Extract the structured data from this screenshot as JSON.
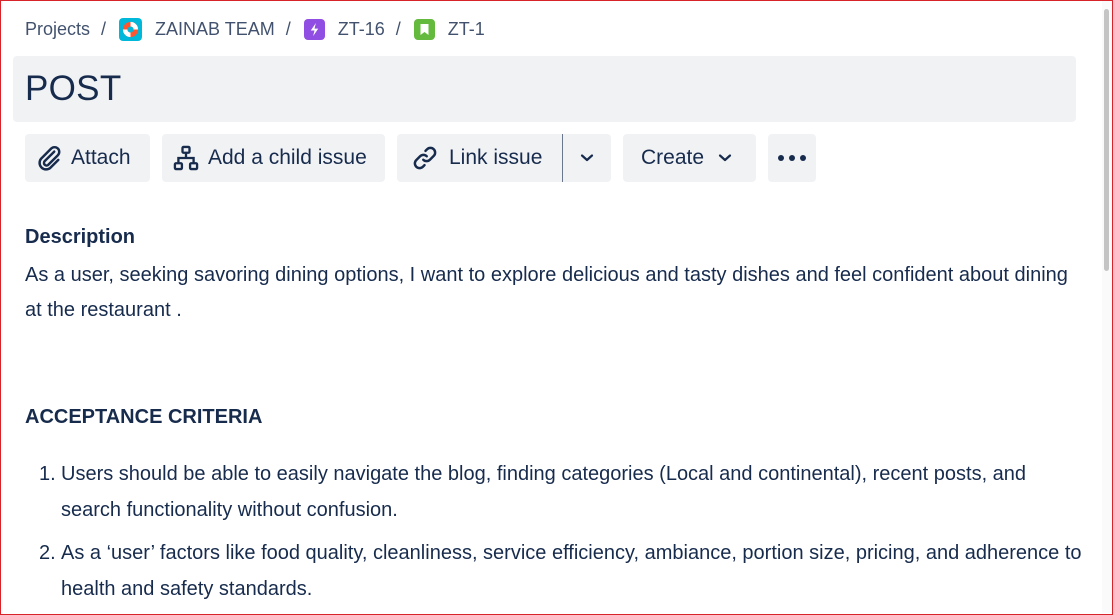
{
  "breadcrumb": {
    "items": [
      {
        "label": "Projects"
      },
      {
        "label": "ZAINAB TEAM",
        "icon": "project-lifebuoy-icon"
      },
      {
        "label": "ZT-16",
        "icon": "epic-lightning-icon"
      },
      {
        "label": "ZT-1",
        "icon": "story-bookmark-icon"
      }
    ],
    "separator": "/"
  },
  "issue": {
    "title": "POST"
  },
  "toolbar": {
    "attach_label": "Attach",
    "child_label": "Add a child issue",
    "link_label": "Link issue",
    "create_label": "Create",
    "more_label": "•••"
  },
  "description": {
    "heading": "Description",
    "body": "As a user, seeking savoring dining options, I want to explore delicious and tasty dishes and feel confident about dining at the restaurant ."
  },
  "acceptance": {
    "heading": "ACCEPTANCE CRITERIA",
    "items": [
      {
        "num": "1.",
        "text": "Users should be able to easily navigate the blog, finding categories (Local and continental), recent posts, and search functionality without confusion."
      },
      {
        "num": "2.",
        "text": "As a ‘user’ factors like food quality, cleanliness, service efficiency, ambiance, portion size, pricing, and adherence to health and safety standards."
      }
    ]
  },
  "colors": {
    "text": "#172b4d",
    "subtle_text": "#42526e",
    "button_bg": "#f1f2f4",
    "project_icon_bg": "#00b8d9",
    "epic_icon_bg": "#904ee2",
    "story_icon_bg": "#63ba3c",
    "frame_border": "#d9232b"
  }
}
